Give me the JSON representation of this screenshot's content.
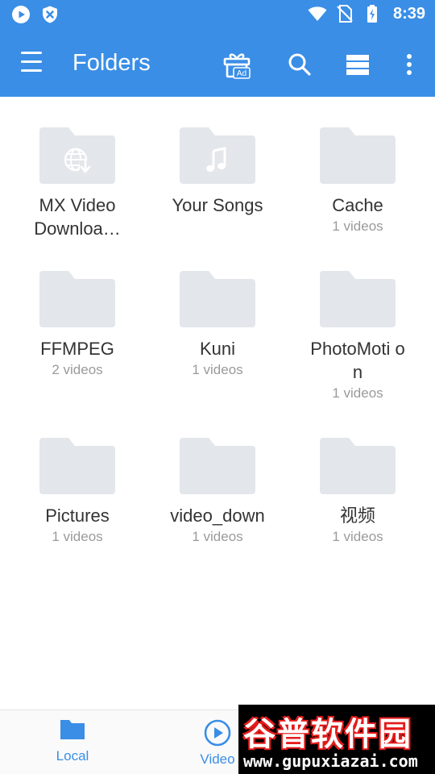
{
  "status_bar": {
    "time": "8:39",
    "icons": [
      "play-notification-icon",
      "shield-notification-icon",
      "wifi-icon",
      "no-sim-icon",
      "battery-charging-icon"
    ]
  },
  "app_bar": {
    "title": "Folders",
    "actions": [
      "gift-ad-icon",
      "search-icon",
      "view-mode-icon",
      "more-vert-icon"
    ],
    "gift_badge": "Ad"
  },
  "folders": [
    {
      "name": "MX Video Downloader",
      "display_name": "MX Video Downloa…",
      "count": "",
      "overlay": "globe-download-icon"
    },
    {
      "name": "Your Songs",
      "display_name": "Your Songs",
      "count": "",
      "overlay": "music-note-icon"
    },
    {
      "name": "Cache",
      "display_name": "Cache",
      "count": "1 videos",
      "overlay": ""
    },
    {
      "name": "FFMPEG",
      "display_name": "FFMPEG",
      "count": "2 videos",
      "overlay": ""
    },
    {
      "name": "Kuni",
      "display_name": "Kuni",
      "count": "1 videos",
      "overlay": ""
    },
    {
      "name": "PhotoMotion",
      "display_name": "PhotoMoti on",
      "count": "1 videos",
      "overlay": ""
    },
    {
      "name": "Pictures",
      "display_name": "Pictures",
      "count": "1 videos",
      "overlay": ""
    },
    {
      "name": "video_down",
      "display_name": "video_down",
      "count": "1 videos",
      "overlay": ""
    },
    {
      "name": "视频",
      "display_name": "视频",
      "count": "1 videos",
      "overlay": ""
    }
  ],
  "bottom_nav": {
    "items": [
      {
        "label": "Local",
        "icon": "folder-icon"
      },
      {
        "label": "Video",
        "icon": "play-circle-icon"
      }
    ]
  },
  "watermark": {
    "title": "谷普软件园",
    "url": "www.gupuxiazai.com"
  },
  "colors": {
    "primary": "#3a8ee6",
    "folder": "#e3e6ea",
    "text": "#333333",
    "subtext": "#9a9a9a"
  }
}
